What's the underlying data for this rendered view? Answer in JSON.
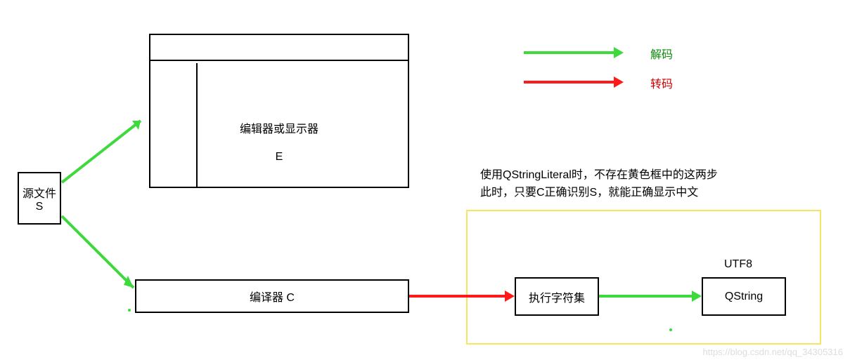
{
  "legend": {
    "decode": "解码",
    "transcode": "转码"
  },
  "nodes": {
    "source": {
      "line1": "源文件",
      "line2": "S"
    },
    "editor": {
      "line1": "编辑器或显示器",
      "line2": "E"
    },
    "compiler": {
      "label": "编译器    C"
    },
    "charset": {
      "label": "执行字符集"
    },
    "qstring": {
      "label": "QString",
      "header": "UTF8"
    }
  },
  "note": {
    "line1": "使用QStringLiteral时，不存在黄色框中的这两步",
    "line2": "此时，只要C正确识别S，就能正确显示中文"
  },
  "watermark": "https://blog.csdn.net/qq_34305316",
  "chart_data": {
    "type": "diagram",
    "nodes": [
      {
        "id": "S",
        "label": "源文件 S"
      },
      {
        "id": "E",
        "label": "编辑器或显示器 E"
      },
      {
        "id": "C",
        "label": "编译器 C"
      },
      {
        "id": "X",
        "label": "执行字符集"
      },
      {
        "id": "Q",
        "label": "QString (UTF8)"
      }
    ],
    "edges": [
      {
        "from": "S",
        "to": "E",
        "kind": "解码",
        "color": "green"
      },
      {
        "from": "S",
        "to": "C",
        "kind": "解码",
        "color": "green"
      },
      {
        "from": "C",
        "to": "X",
        "kind": "转码",
        "color": "red"
      },
      {
        "from": "X",
        "to": "Q",
        "kind": "解码",
        "color": "green"
      }
    ],
    "highlight_group": {
      "members": [
        "X",
        "Q"
      ],
      "style": "yellow-box",
      "note": "使用QStringLiteral时，不存在黄色框中的这两步；此时，只要C正确识别S，就能正确显示中文"
    },
    "legend": {
      "green": "解码",
      "red": "转码"
    }
  }
}
